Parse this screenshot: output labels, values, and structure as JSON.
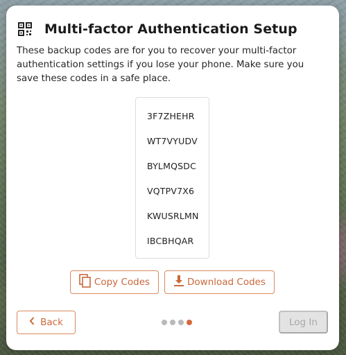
{
  "dialog": {
    "title": "Multi-factor Authentication Setup",
    "description": "These backup codes are for you to recover your multi-factor authentication settings if you lose your phone. Make sure you save these codes in a safe place.",
    "codes": [
      "3F7ZHEHR",
      "WT7VYUDV",
      "BYLMQSDC",
      "VQTPV7X6",
      "KWUSRLMN",
      "IBCBHQAR"
    ],
    "copy_label": "Copy Codes",
    "download_label": "Download Codes",
    "back_label": "Back",
    "login_label": "Log In",
    "steps_total": 4,
    "current_step": 4
  },
  "icons": {
    "header": "qr-code-icon",
    "copy": "copy-icon",
    "download": "download-icon",
    "back": "chevron-left-icon"
  },
  "colors": {
    "accent": "#c9683b",
    "accent_border": "#d9895e",
    "dot_inactive": "#b9b9b9",
    "dot_active": "#d2693c",
    "disabled_bg": "#e3e3e3",
    "disabled_text": "#a8a8a8"
  }
}
